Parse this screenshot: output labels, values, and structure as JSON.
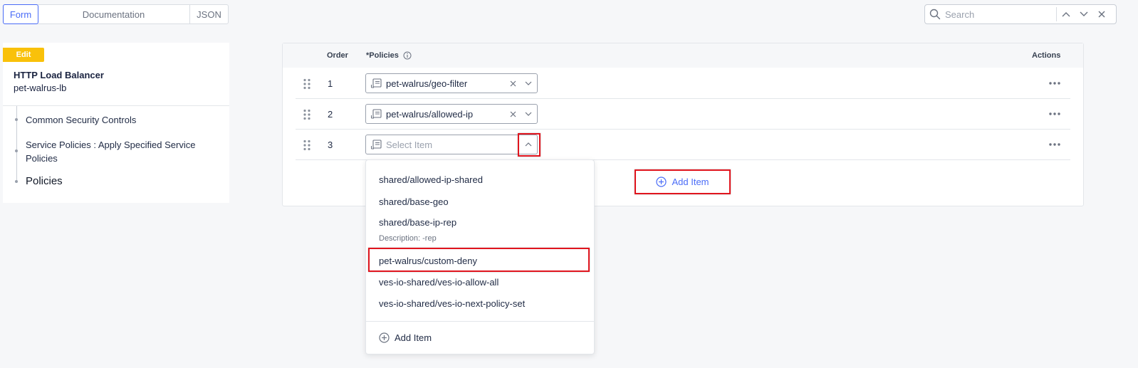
{
  "tabs": {
    "form": "Form",
    "documentation": "Documentation",
    "json": "JSON"
  },
  "search": {
    "placeholder": "Search"
  },
  "sidebar": {
    "badge": "Edit",
    "title": "HTTP Load Balancer",
    "subtitle": "pet-walrus-lb",
    "items": [
      {
        "label": "Common Security Controls"
      },
      {
        "label": "Service Policies : Apply Specified Service Policies"
      },
      {
        "label": "Policies"
      }
    ]
  },
  "table": {
    "headers": {
      "order": "Order",
      "policies": "*Policies",
      "actions": "Actions"
    },
    "rows": [
      {
        "order": "1",
        "value": "pet-walrus/geo-filter"
      },
      {
        "order": "2",
        "value": "pet-walrus/allowed-ip"
      },
      {
        "order": "3",
        "placeholder": "Select Item"
      }
    ],
    "add_item": "Add Item"
  },
  "dropdown": {
    "options": [
      {
        "label": "shared/allowed-ip-shared"
      },
      {
        "label": "shared/base-geo"
      },
      {
        "label": "shared/base-ip-rep",
        "description": "Description: -rep"
      },
      {
        "label": "pet-walrus/custom-deny"
      },
      {
        "label": "ves-io-shared/ves-io-allow-all"
      },
      {
        "label": "ves-io-shared/ves-io-next-policy-set"
      }
    ],
    "add_item": "Add Item"
  },
  "colors": {
    "accent": "#4a6cf7",
    "badge": "#f9c10a",
    "highlight": "#e0151e"
  }
}
